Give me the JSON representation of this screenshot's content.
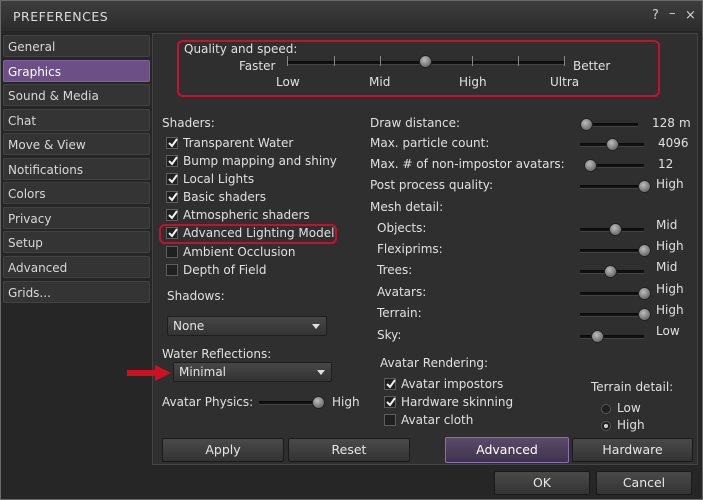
{
  "window": {
    "title": "PREFERENCES",
    "help_glyph": "?",
    "minimize_glyph": "–",
    "close_glyph": "×"
  },
  "tabs": [
    {
      "label": "General"
    },
    {
      "label": "Graphics"
    },
    {
      "label": "Sound & Media"
    },
    {
      "label": "Chat"
    },
    {
      "label": "Move & View"
    },
    {
      "label": "Notifications"
    },
    {
      "label": "Colors"
    },
    {
      "label": "Privacy"
    },
    {
      "label": "Setup"
    },
    {
      "label": "Advanced"
    },
    {
      "label": "Grids..."
    }
  ],
  "quality": {
    "heading": "Quality and speed:",
    "left_label": "Faster",
    "right_label": "Better",
    "ticks": [
      "Low",
      "Mid",
      "High",
      "Ultra"
    ],
    "level_fraction": 0.5
  },
  "shaders": {
    "heading": "Shaders:",
    "items": [
      {
        "label": "Transparent Water",
        "checked": true
      },
      {
        "label": "Bump mapping and shiny",
        "checked": true
      },
      {
        "label": "Local Lights",
        "checked": true
      },
      {
        "label": "Basic shaders",
        "checked": true
      },
      {
        "label": "Atmospheric shaders",
        "checked": true
      },
      {
        "label": "Advanced Lighting Model",
        "checked": true
      },
      {
        "label": "Ambient Occlusion",
        "checked": false
      },
      {
        "label": "Depth of Field",
        "checked": false
      }
    ]
  },
  "shadows": {
    "label": "Shadows:",
    "value": "None"
  },
  "water": {
    "label": "Water Reflections:",
    "value": "Minimal"
  },
  "avatar_physics": {
    "label": "Avatar Physics:",
    "value_text": "High",
    "level_fraction": 1.0
  },
  "right": {
    "draw_distance": {
      "label": "Draw distance:",
      "value": "128",
      "unit": "m",
      "level_fraction": 0.1
    },
    "particle_count": {
      "label": "Max. particle count:",
      "value": "4096",
      "level_fraction": 0.5
    },
    "non_impostor": {
      "label": "Max. # of non-impostor avatars:",
      "value": "12",
      "level_fraction": 0.12
    },
    "post_process": {
      "label": "Post process quality:",
      "value": "High",
      "level_fraction": 1.0
    },
    "mesh_heading": "Mesh detail:",
    "mesh": [
      {
        "label": "Objects:",
        "value": "Mid",
        "level_fraction": 0.55
      },
      {
        "label": "Flexiprims:",
        "value": "High",
        "level_fraction": 1.0
      },
      {
        "label": "Trees:",
        "value": "Mid",
        "level_fraction": 0.45
      },
      {
        "label": "Avatars:",
        "value": "High",
        "level_fraction": 1.0
      },
      {
        "label": "Terrain:",
        "value": "High",
        "level_fraction": 1.0
      },
      {
        "label": "Sky:",
        "value": "Low",
        "level_fraction": 0.25
      }
    ]
  },
  "avatar_rendering": {
    "heading": "Avatar Rendering:",
    "items": [
      {
        "label": "Avatar impostors",
        "checked": true
      },
      {
        "label": "Hardware skinning",
        "checked": true
      },
      {
        "label": "Avatar cloth",
        "checked": false
      }
    ]
  },
  "terrain_detail": {
    "heading": "Terrain detail:",
    "options": [
      "Low",
      "High"
    ],
    "selected": "High"
  },
  "panel_buttons": {
    "apply": "Apply",
    "reset": "Reset",
    "advanced": "Advanced",
    "hardware": "Hardware"
  },
  "dialog_buttons": {
    "ok": "OK",
    "cancel": "Cancel"
  },
  "colors": {
    "accent_tab": "#6b4f86",
    "highlight_red": "#c8102e"
  }
}
